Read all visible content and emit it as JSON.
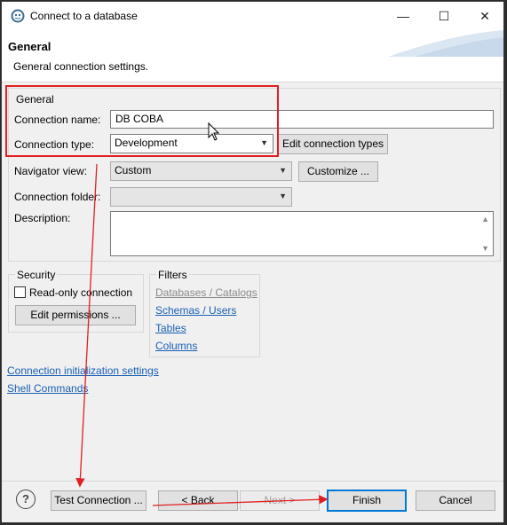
{
  "window": {
    "title": "Connect to a database",
    "minimize_glyph": "—",
    "maximize_glyph": "☐",
    "close_glyph": "✕"
  },
  "header": {
    "title": "General",
    "subtitle": "General connection settings."
  },
  "general_group": {
    "label": "General",
    "connection_name_label": "Connection name:",
    "connection_name_value": "DB COBA",
    "connection_type_label": "Connection type:",
    "connection_type_value": "Development",
    "edit_connection_types_label": "Edit connection types",
    "navigator_view_label": "Navigator view:",
    "navigator_view_value": "Custom",
    "customize_label": "Customize ...",
    "connection_folder_label": "Connection folder:",
    "connection_folder_value": "",
    "description_label": "Description:",
    "description_value": ""
  },
  "security": {
    "label": "Security",
    "read_only_label": "Read-only connection",
    "read_only_checked": false,
    "edit_permissions_label": "Edit permissions ..."
  },
  "filters": {
    "label": "Filters",
    "items": [
      "Databases / Catalogs",
      "Schemas / Users",
      "Tables",
      "Columns"
    ]
  },
  "links": {
    "init_settings": "Connection initialization settings",
    "shell_commands": "Shell Commands"
  },
  "footer": {
    "help_glyph": "?",
    "test_connection_label": "Test Connection ...",
    "back_label": "< Back",
    "next_label": "Next >",
    "finish_label": "Finish",
    "cancel_label": "Cancel"
  },
  "colors": {
    "annotation_red": "#e02020",
    "link_blue": "#1a5fb4",
    "default_button_border": "#0078d7"
  }
}
